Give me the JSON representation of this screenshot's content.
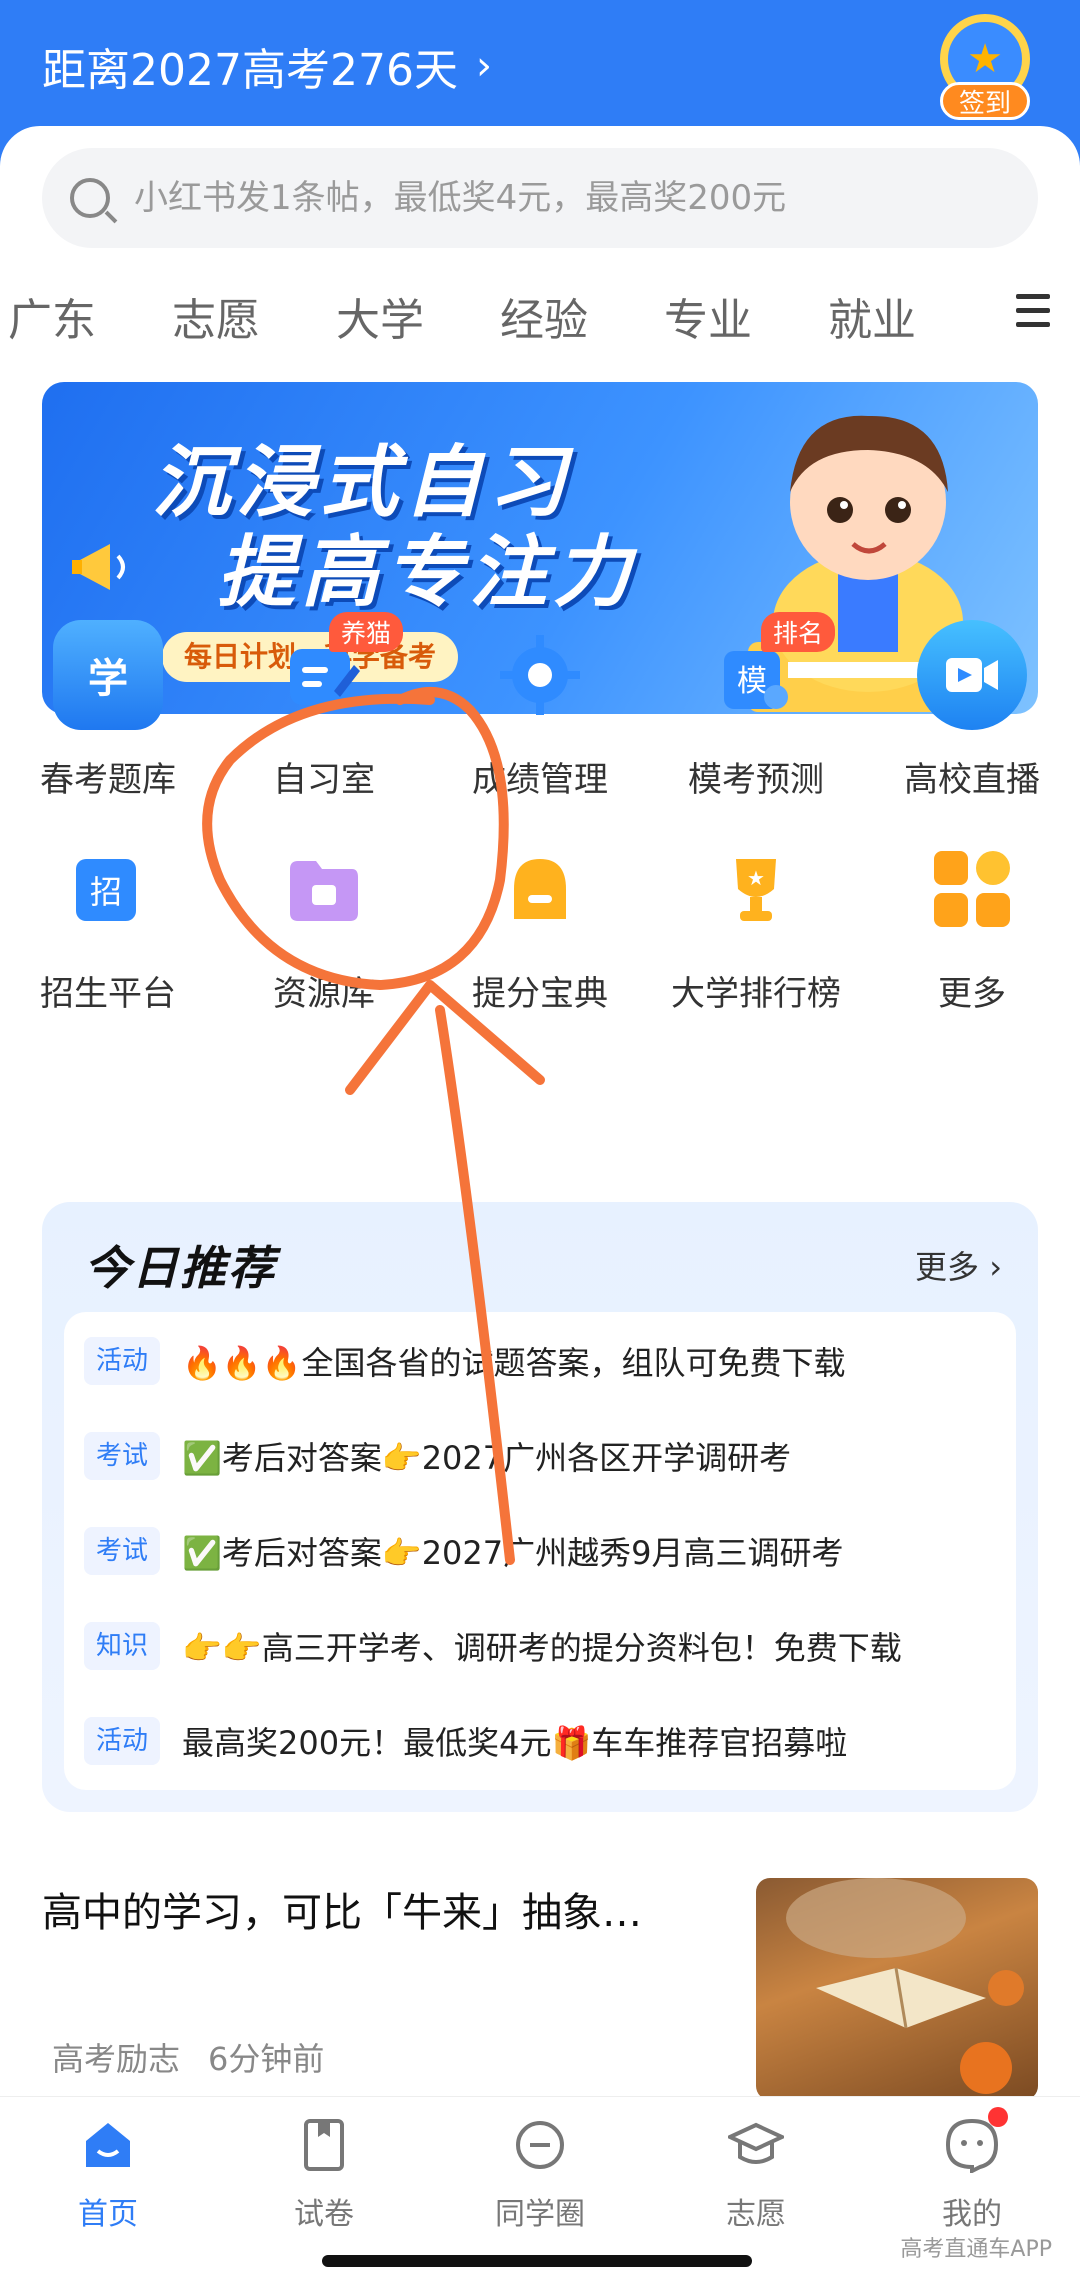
{
  "header": {
    "countdown": "距离2027高考276天",
    "checkin_label": "签到",
    "color": "#2f7df6"
  },
  "search": {
    "placeholder": "小红书发1条帖，最低奖4元，最高奖200元"
  },
  "tabs": [
    "广东",
    "志愿",
    "大学",
    "经验",
    "专业",
    "就业"
  ],
  "banner": {
    "line1": "沉浸式自习",
    "line2": "提高专注力",
    "pill": "每日计划，科学备考"
  },
  "grid": [
    {
      "label": "春考题库",
      "icon": "question-bank-icon"
    },
    {
      "label": "自习室",
      "icon": "study-room-icon",
      "badge": "养猫"
    },
    {
      "label": "成绩管理",
      "icon": "score-management-icon"
    },
    {
      "label": "模考预测",
      "icon": "mock-exam-icon",
      "badge": "排名"
    },
    {
      "label": "高校直播",
      "icon": "live-stream-icon"
    },
    {
      "label": "招生平台",
      "icon": "admissions-icon"
    },
    {
      "label": "资源库",
      "icon": "resource-folder-icon"
    },
    {
      "label": "提分宝典",
      "icon": "backpack-icon"
    },
    {
      "label": "大学排行榜",
      "icon": "trophy-icon"
    },
    {
      "label": "更多",
      "icon": "more-grid-icon"
    }
  ],
  "recommend": {
    "title": "今日推荐",
    "more": "更多",
    "items": [
      {
        "tag": "活动",
        "text": "🔥🔥🔥全国各省的试题答案，组队可免费下载"
      },
      {
        "tag": "考试",
        "text": "✅考后对答案👉2027广州各区开学调研考"
      },
      {
        "tag": "考试",
        "text": "✅考后对答案👉2027广州越秀9月高三调研考"
      },
      {
        "tag": "知识",
        "text": "👉👉高三开学考、调研考的提分资料包！免费下载"
      },
      {
        "tag": "活动",
        "text": "最高奖200元！最低奖4元🎁车车推荐官招募啦"
      }
    ]
  },
  "article": {
    "title": "高中的学习，可比「牛来」抽象…",
    "category": "高考励志",
    "time": "6分钟前"
  },
  "bottom_nav": [
    {
      "label": "首页",
      "icon": "home-icon",
      "active": true
    },
    {
      "label": "试卷",
      "icon": "exam-paper-icon"
    },
    {
      "label": "同学圈",
      "icon": "classmates-icon"
    },
    {
      "label": "志愿",
      "icon": "graduation-cap-icon"
    },
    {
      "label": "我的",
      "icon": "profile-icon"
    }
  ],
  "watermark": "高考直通车APP"
}
